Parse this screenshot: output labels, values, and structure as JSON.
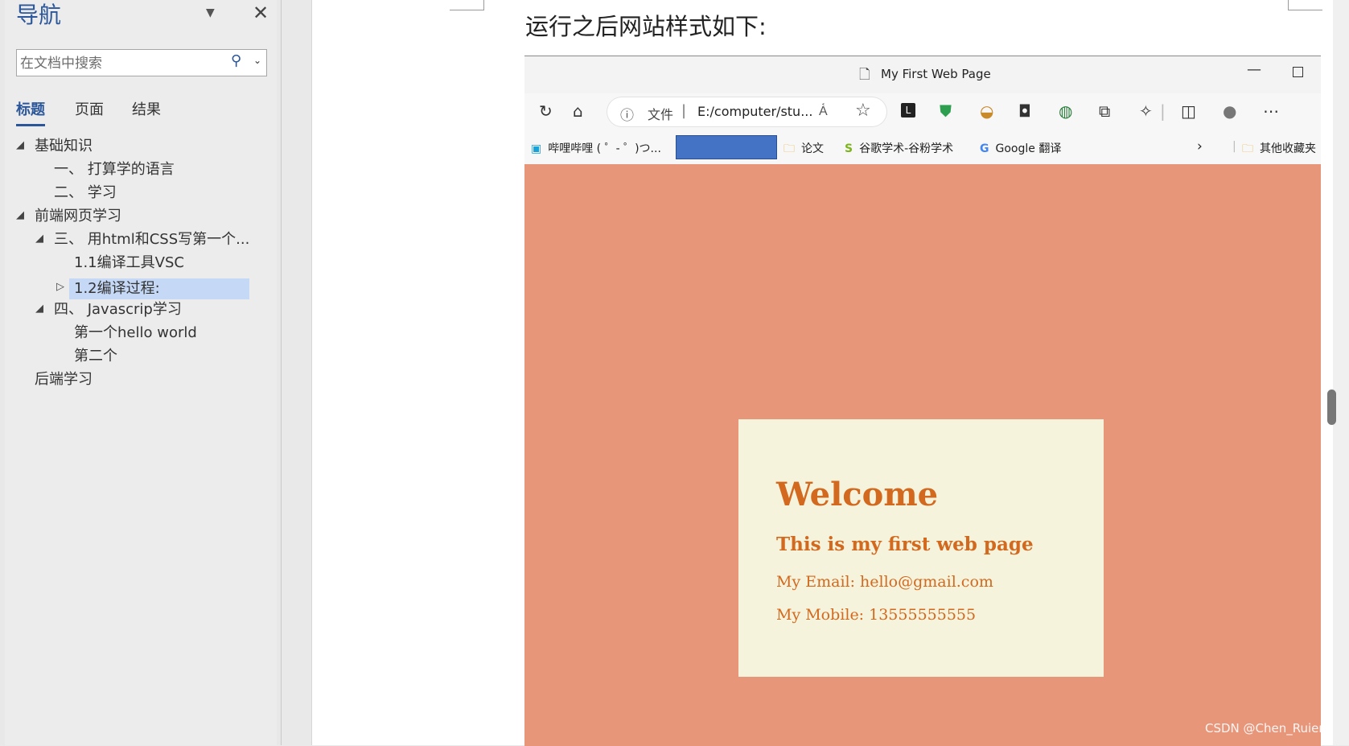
{
  "nav": {
    "title": "导航",
    "search_placeholder": "在文档中搜索",
    "tabs": [
      {
        "label": "标题",
        "active": true
      },
      {
        "label": "页面",
        "active": false
      },
      {
        "label": "结果",
        "active": false
      }
    ],
    "tree": [
      {
        "label": "基础知识",
        "expanded": true
      },
      {
        "label": "一、 打算学的语言"
      },
      {
        "label": "二、 学习"
      },
      {
        "label": "前端网页学习",
        "expanded": true
      },
      {
        "label": "三、 用html和CSS写第一个...",
        "expanded": true
      },
      {
        "label": "1.1编译工具VSC"
      },
      {
        "label": "1.2编译过程:",
        "selected": true,
        "expanded": false
      },
      {
        "label": "四、 Javascrip学习",
        "expanded": true
      },
      {
        "label": "第一个hello world"
      },
      {
        "label": "第二个"
      },
      {
        "label": "后端学习"
      }
    ]
  },
  "document": {
    "text": "运行之后网站样式如下:"
  },
  "browser": {
    "tab_title": "My First Web Page",
    "address": {
      "scheme_label": "文件",
      "url": "E:/computer/stu..."
    },
    "bookmarks": [
      {
        "label": "哔哩哔哩 ( ゜- ゜)つ...",
        "icon": "bilibili-icon"
      },
      {
        "label": "论文",
        "icon": "folder-icon"
      },
      {
        "label": "谷歌学术-谷粉学术",
        "icon": "scholar-icon"
      },
      {
        "label": "Google 翻译",
        "icon": "translate-icon"
      },
      {
        "label": "其他收藏夹",
        "icon": "folder-icon"
      }
    ],
    "page": {
      "heading": "Welcome",
      "subheading": "This is my first web page",
      "email": "My Email: hello@gmail.com",
      "mobile": "My Mobile: 13555555555"
    }
  },
  "watermark": "CSDN @Chen_Ruieng",
  "colors": {
    "accent": "#2b579a",
    "selected_row": "#c5d8f5",
    "page_bg": "#e8967a",
    "card_bg": "#f5f3dc",
    "card_text": "#d2691e"
  }
}
